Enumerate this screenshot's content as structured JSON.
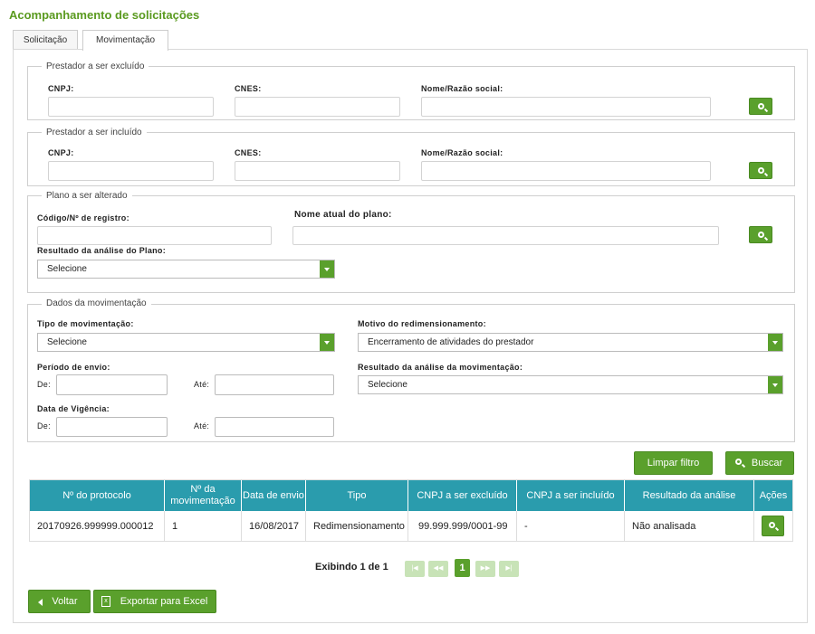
{
  "page_title": "Acompanhamento de solicitações",
  "tabs": [
    {
      "label": "Solicitação"
    },
    {
      "label": "Movimentação"
    }
  ],
  "excluded": {
    "legend": "Prestador a ser excluído",
    "cnpj_label": "CNPJ:",
    "cnes_label": "CNES:",
    "nome_label": "Nome/Razão social:"
  },
  "included": {
    "legend": "Prestador a ser incluído",
    "cnpj_label": "CNPJ:",
    "cnes_label": "CNES:",
    "nome_label": "Nome/Razão social:"
  },
  "plano": {
    "legend": "Plano a ser alterado",
    "codigo_label": "Código/Nº de registro:",
    "nome_label": "Nome atual do plano:",
    "resultado_label": "Resultado da análise do Plano:",
    "resultado_value": "Selecione"
  },
  "mov": {
    "legend": "Dados da movimentação",
    "tipo_label": "Tipo de movimentação:",
    "tipo_value": "Selecione",
    "motivo_label": "Motivo do redimensionamento:",
    "motivo_value": "Encerramento de atividades do prestador",
    "envio_label": "Período de envio:",
    "de_label": "De:",
    "ate_label": "Até:",
    "resultado_label": "Resultado da análise da movimentação:",
    "resultado_value": "Selecione",
    "vigencia_label": "Data de Vigência:"
  },
  "buttons": {
    "limpar": "Limpar filtro",
    "buscar": "Buscar",
    "voltar": "Voltar",
    "exportar": "Exportar para Excel"
  },
  "table": {
    "headers": [
      "Nº do protocolo",
      "Nº da movimentação",
      "Data de envio",
      "Tipo",
      "CNPJ a ser excluído",
      "CNPJ a ser incluído",
      "Resultado da análise",
      "Ações"
    ],
    "rows": [
      [
        "20170926.999999.000012",
        "1",
        "16/08/2017",
        "Redimensionamento",
        "99.999.999/0001-99",
        "-",
        "Não analisada"
      ]
    ]
  },
  "pagination": {
    "summary": "Exibindo 1 de 1",
    "current_page": "1"
  },
  "colors": {
    "accent": "#5aa02c",
    "table_header": "#2a9cad",
    "title": "#5a9a1f"
  }
}
